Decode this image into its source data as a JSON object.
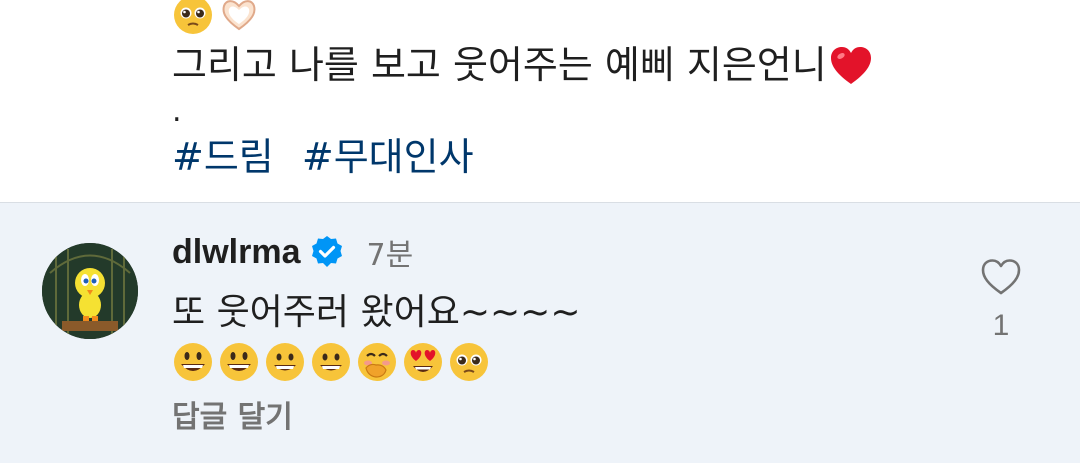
{
  "caption": {
    "top_emojis": [
      "pleading-face-icon",
      "heart-hands-icon"
    ],
    "text": "그리고 나를 보고 웃어주는 예삐 지은언니",
    "text_trailing_icon": "red-heart-icon",
    "separator": ".",
    "hashtags": [
      "#드림",
      "#무대인사"
    ]
  },
  "comment": {
    "username": "dlwlrma",
    "verified": true,
    "timestamp": "7분",
    "text": "또 웃어주러 왔어요~~~~",
    "emojis": [
      "grinning-face-icon",
      "grinning-face-icon",
      "grinning-smile-face-icon",
      "grinning-smile-face-icon",
      "hand-over-mouth-face-icon",
      "heart-eyes-face-icon",
      "pleading-face-icon"
    ],
    "reply_label": "답글 달기",
    "like_count": "1"
  },
  "colors": {
    "hashtag": "#00376b",
    "verified_badge": "#0095f6",
    "comment_background": "#eef3f9",
    "secondary_text": "#737373"
  }
}
